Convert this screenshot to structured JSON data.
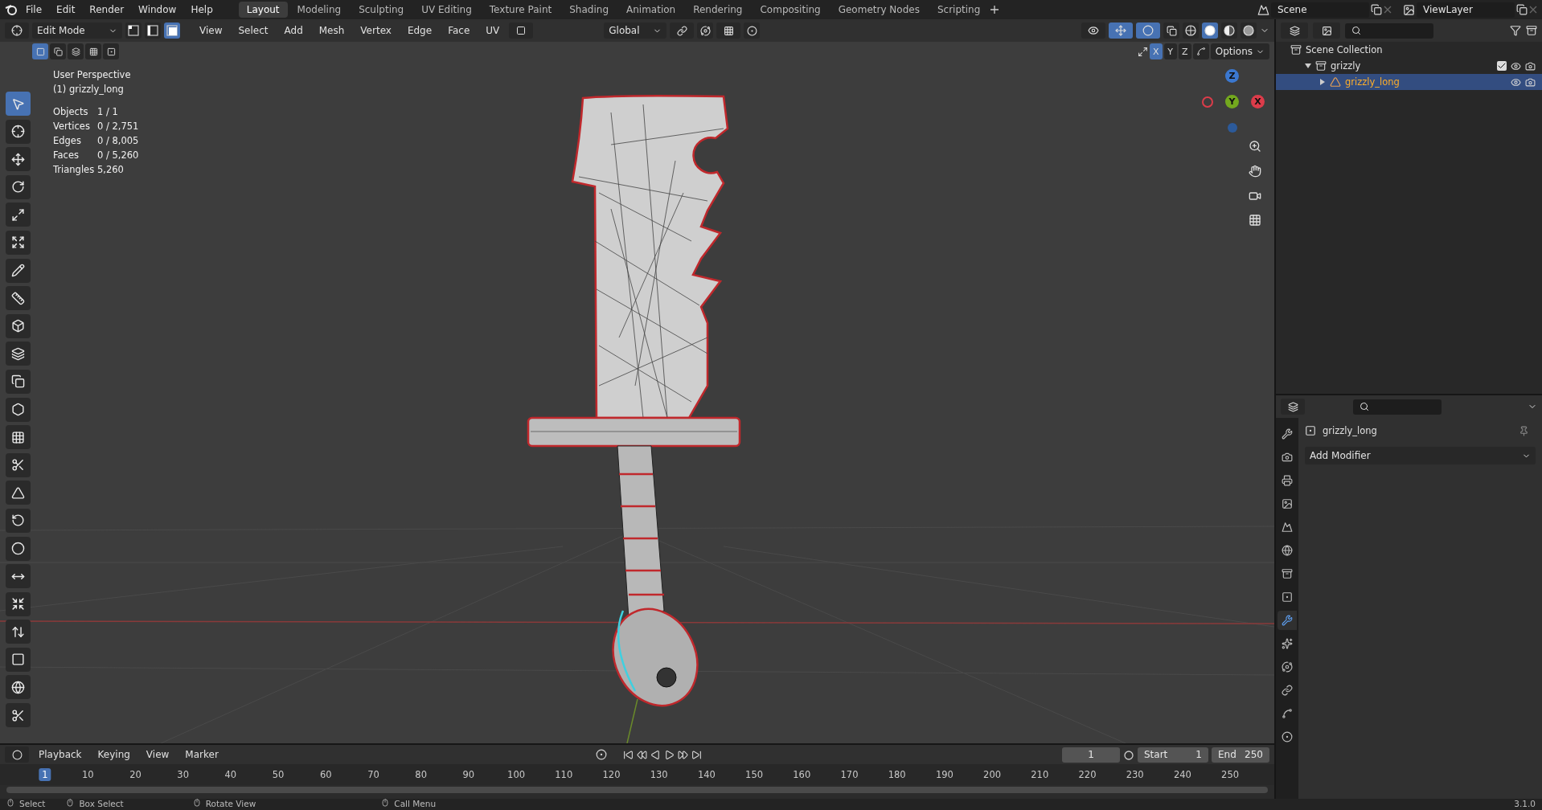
{
  "menu_bar": {
    "menus": [
      "File",
      "Edit",
      "Render",
      "Window",
      "Help"
    ],
    "workspaces": [
      {
        "label": "Layout",
        "selected": true
      },
      {
        "label": "Modeling",
        "selected": false
      },
      {
        "label": "Sculpting",
        "selected": false
      },
      {
        "label": "UV Editing",
        "selected": false
      },
      {
        "label": "Texture Paint",
        "selected": false
      },
      {
        "label": "Shading",
        "selected": false
      },
      {
        "label": "Animation",
        "selected": false
      },
      {
        "label": "Rendering",
        "selected": false
      },
      {
        "label": "Compositing",
        "selected": false
      },
      {
        "label": "Geometry Nodes",
        "selected": false
      },
      {
        "label": "Scripting",
        "selected": false
      }
    ],
    "scene": "Scene",
    "view_layer": "ViewLayer"
  },
  "viewport_header": {
    "mode": "Edit Mode",
    "select_modes": [
      {
        "kind": "vertex",
        "selected": false
      },
      {
        "kind": "edge",
        "selected": false
      },
      {
        "kind": "face",
        "selected": true
      }
    ],
    "menus": [
      "View",
      "Select",
      "Add",
      "Mesh",
      "Vertex",
      "Edge",
      "Face",
      "UV"
    ],
    "orientation": "Global",
    "shading": [
      {
        "kind": "wireframe",
        "selected": false
      },
      {
        "kind": "solid",
        "selected": true
      },
      {
        "kind": "material",
        "selected": false
      },
      {
        "kind": "rendered",
        "selected": false
      }
    ],
    "mirror_axes": [
      {
        "label": "X",
        "selected": true
      },
      {
        "label": "Y",
        "selected": false
      },
      {
        "label": "Z",
        "selected": false
      }
    ],
    "options": "Options",
    "box_select_modes": [
      {
        "kind": "set",
        "selected": true
      },
      {
        "kind": "extend",
        "selected": false
      },
      {
        "kind": "subtract",
        "selected": false
      },
      {
        "kind": "invert",
        "selected": false
      },
      {
        "kind": "intersect",
        "selected": false
      }
    ]
  },
  "overlay": {
    "view_name": "User Perspective",
    "object": "(1) grizzly_long",
    "stats": [
      {
        "label": "Objects",
        "value": "1 / 1"
      },
      {
        "label": "Vertices",
        "value": "0 / 2,751"
      },
      {
        "label": "Edges",
        "value": "0 / 8,005"
      },
      {
        "label": "Faces",
        "value": "0 / 5,260"
      },
      {
        "label": "Triangles",
        "value": "5,260"
      }
    ]
  },
  "tools": [
    {
      "kind": "select",
      "selected": true
    },
    {
      "kind": "cursor",
      "selected": false
    },
    {
      "kind": "move",
      "selected": false
    },
    {
      "kind": "rotate",
      "selected": false
    },
    {
      "kind": "scale",
      "selected": false
    },
    {
      "kind": "transform",
      "selected": false
    },
    {
      "kind": "annotate",
      "selected": false
    },
    {
      "kind": "measure",
      "selected": false
    },
    {
      "kind": "add_cube",
      "selected": false
    },
    {
      "kind": "extrude",
      "selected": false
    },
    {
      "kind": "inset",
      "selected": false
    },
    {
      "kind": "bevel",
      "selected": false
    },
    {
      "kind": "loop_cut",
      "selected": false
    },
    {
      "kind": "knife",
      "selected": false
    },
    {
      "kind": "poly_build",
      "selected": false
    },
    {
      "kind": "spin",
      "selected": false
    },
    {
      "kind": "smooth",
      "selected": false
    },
    {
      "kind": "edge_slide",
      "selected": false
    },
    {
      "kind": "shrink",
      "selected": false
    },
    {
      "kind": "push_pull",
      "selected": false
    },
    {
      "kind": "shear",
      "selected": false
    },
    {
      "kind": "to_sphere",
      "selected": false
    },
    {
      "kind": "rip",
      "selected": false
    }
  ],
  "gizmo": {
    "axes": [
      {
        "label": "Z",
        "color": "#3b78d0"
      },
      {
        "label": "Y",
        "color": "#73a81e"
      },
      {
        "label": "X",
        "color": "#dc3c4a"
      }
    ]
  },
  "outliner": {
    "items": [
      {
        "label": "Scene Collection",
        "kind": "scene_collection",
        "children": [
          {
            "label": "grizzly",
            "kind": "collection",
            "expanded": true,
            "checked": true,
            "children": [
              {
                "label": "grizzly_long",
                "kind": "mesh",
                "expanded": false,
                "selected": true
              }
            ]
          }
        ]
      }
    ]
  },
  "properties": {
    "object": "grizzly_long",
    "add_modifier": "Add Modifier",
    "tabs": [
      {
        "kind": "tool",
        "selected": false
      },
      {
        "kind": "render",
        "selected": false
      },
      {
        "kind": "output",
        "selected": false
      },
      {
        "kind": "view_layer",
        "selected": false
      },
      {
        "kind": "scene",
        "selected": false
      },
      {
        "kind": "world",
        "selected": false
      },
      {
        "kind": "collection",
        "selected": false
      },
      {
        "kind": "object",
        "selected": false
      },
      {
        "kind": "modifiers",
        "selected": true
      },
      {
        "kind": "particles",
        "selected": false
      },
      {
        "kind": "physics",
        "selected": false
      },
      {
        "kind": "constraints",
        "selected": false
      },
      {
        "kind": "data",
        "selected": false
      },
      {
        "kind": "material",
        "selected": false
      }
    ]
  },
  "timeline": {
    "menus": [
      "Playback",
      "Keying",
      "View",
      "Marker"
    ],
    "current_frame": "1",
    "start_label": "Start",
    "start": "1",
    "end_label": "End",
    "end": "250",
    "ticks": [
      {
        "label": "1",
        "selected": true
      },
      {
        "label": "10",
        "selected": false
      },
      {
        "label": "20",
        "selected": false
      },
      {
        "label": "30",
        "selected": false
      },
      {
        "label": "40",
        "selected": false
      },
      {
        "label": "50",
        "selected": false
      },
      {
        "label": "60",
        "selected": false
      },
      {
        "label": "70",
        "selected": false
      },
      {
        "label": "80",
        "selected": false
      },
      {
        "label": "90",
        "selected": false
      },
      {
        "label": "100",
        "selected": false
      },
      {
        "label": "110",
        "selected": false
      },
      {
        "label": "120",
        "selected": false
      },
      {
        "label": "130",
        "selected": false
      },
      {
        "label": "140",
        "selected": false
      },
      {
        "label": "150",
        "selected": false
      },
      {
        "label": "160",
        "selected": false
      },
      {
        "label": "170",
        "selected": false
      },
      {
        "label": "180",
        "selected": false
      },
      {
        "label": "190",
        "selected": false
      },
      {
        "label": "200",
        "selected": false
      },
      {
        "label": "210",
        "selected": false
      },
      {
        "label": "220",
        "selected": false
      },
      {
        "label": "230",
        "selected": false
      },
      {
        "label": "240",
        "selected": false
      },
      {
        "label": "250",
        "selected": false
      }
    ]
  },
  "status_bar": {
    "items": [
      "Select",
      "Box Select",
      "Rotate View",
      "Call Menu"
    ],
    "version": "3.1.0"
  }
}
